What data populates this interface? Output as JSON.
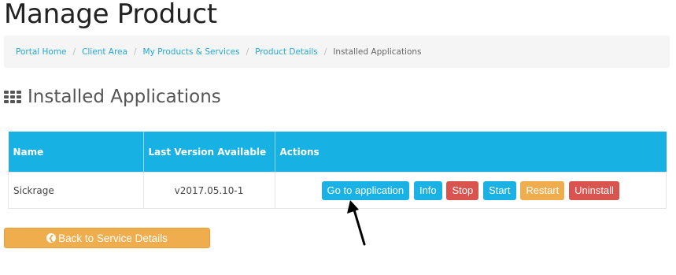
{
  "page": {
    "title": "Manage Product"
  },
  "breadcrumb": {
    "items": [
      "Portal Home",
      "Client Area",
      "My Products & Services",
      "Product Details"
    ],
    "active": "Installed Applications",
    "separator": "/"
  },
  "section": {
    "title": "Installed Applications",
    "icon": "th-grid-icon"
  },
  "table": {
    "headers": {
      "name": "Name",
      "version": "Last Version Available",
      "actions": "Actions"
    },
    "rows": [
      {
        "name": "Sickrage",
        "version": "v2017.05.10-1",
        "actions": [
          "Go to application",
          "Info",
          "Stop",
          "Start",
          "Restart",
          "Uninstall"
        ]
      }
    ]
  },
  "back_button": {
    "label": "Back to Service Details",
    "icon": "circle-arrow-left-icon"
  },
  "colors": {
    "accent": "#17b1e3",
    "info": "#1ab2e4",
    "danger": "#d9534f",
    "warning": "#f0ad4e",
    "link": "#1faad9"
  }
}
